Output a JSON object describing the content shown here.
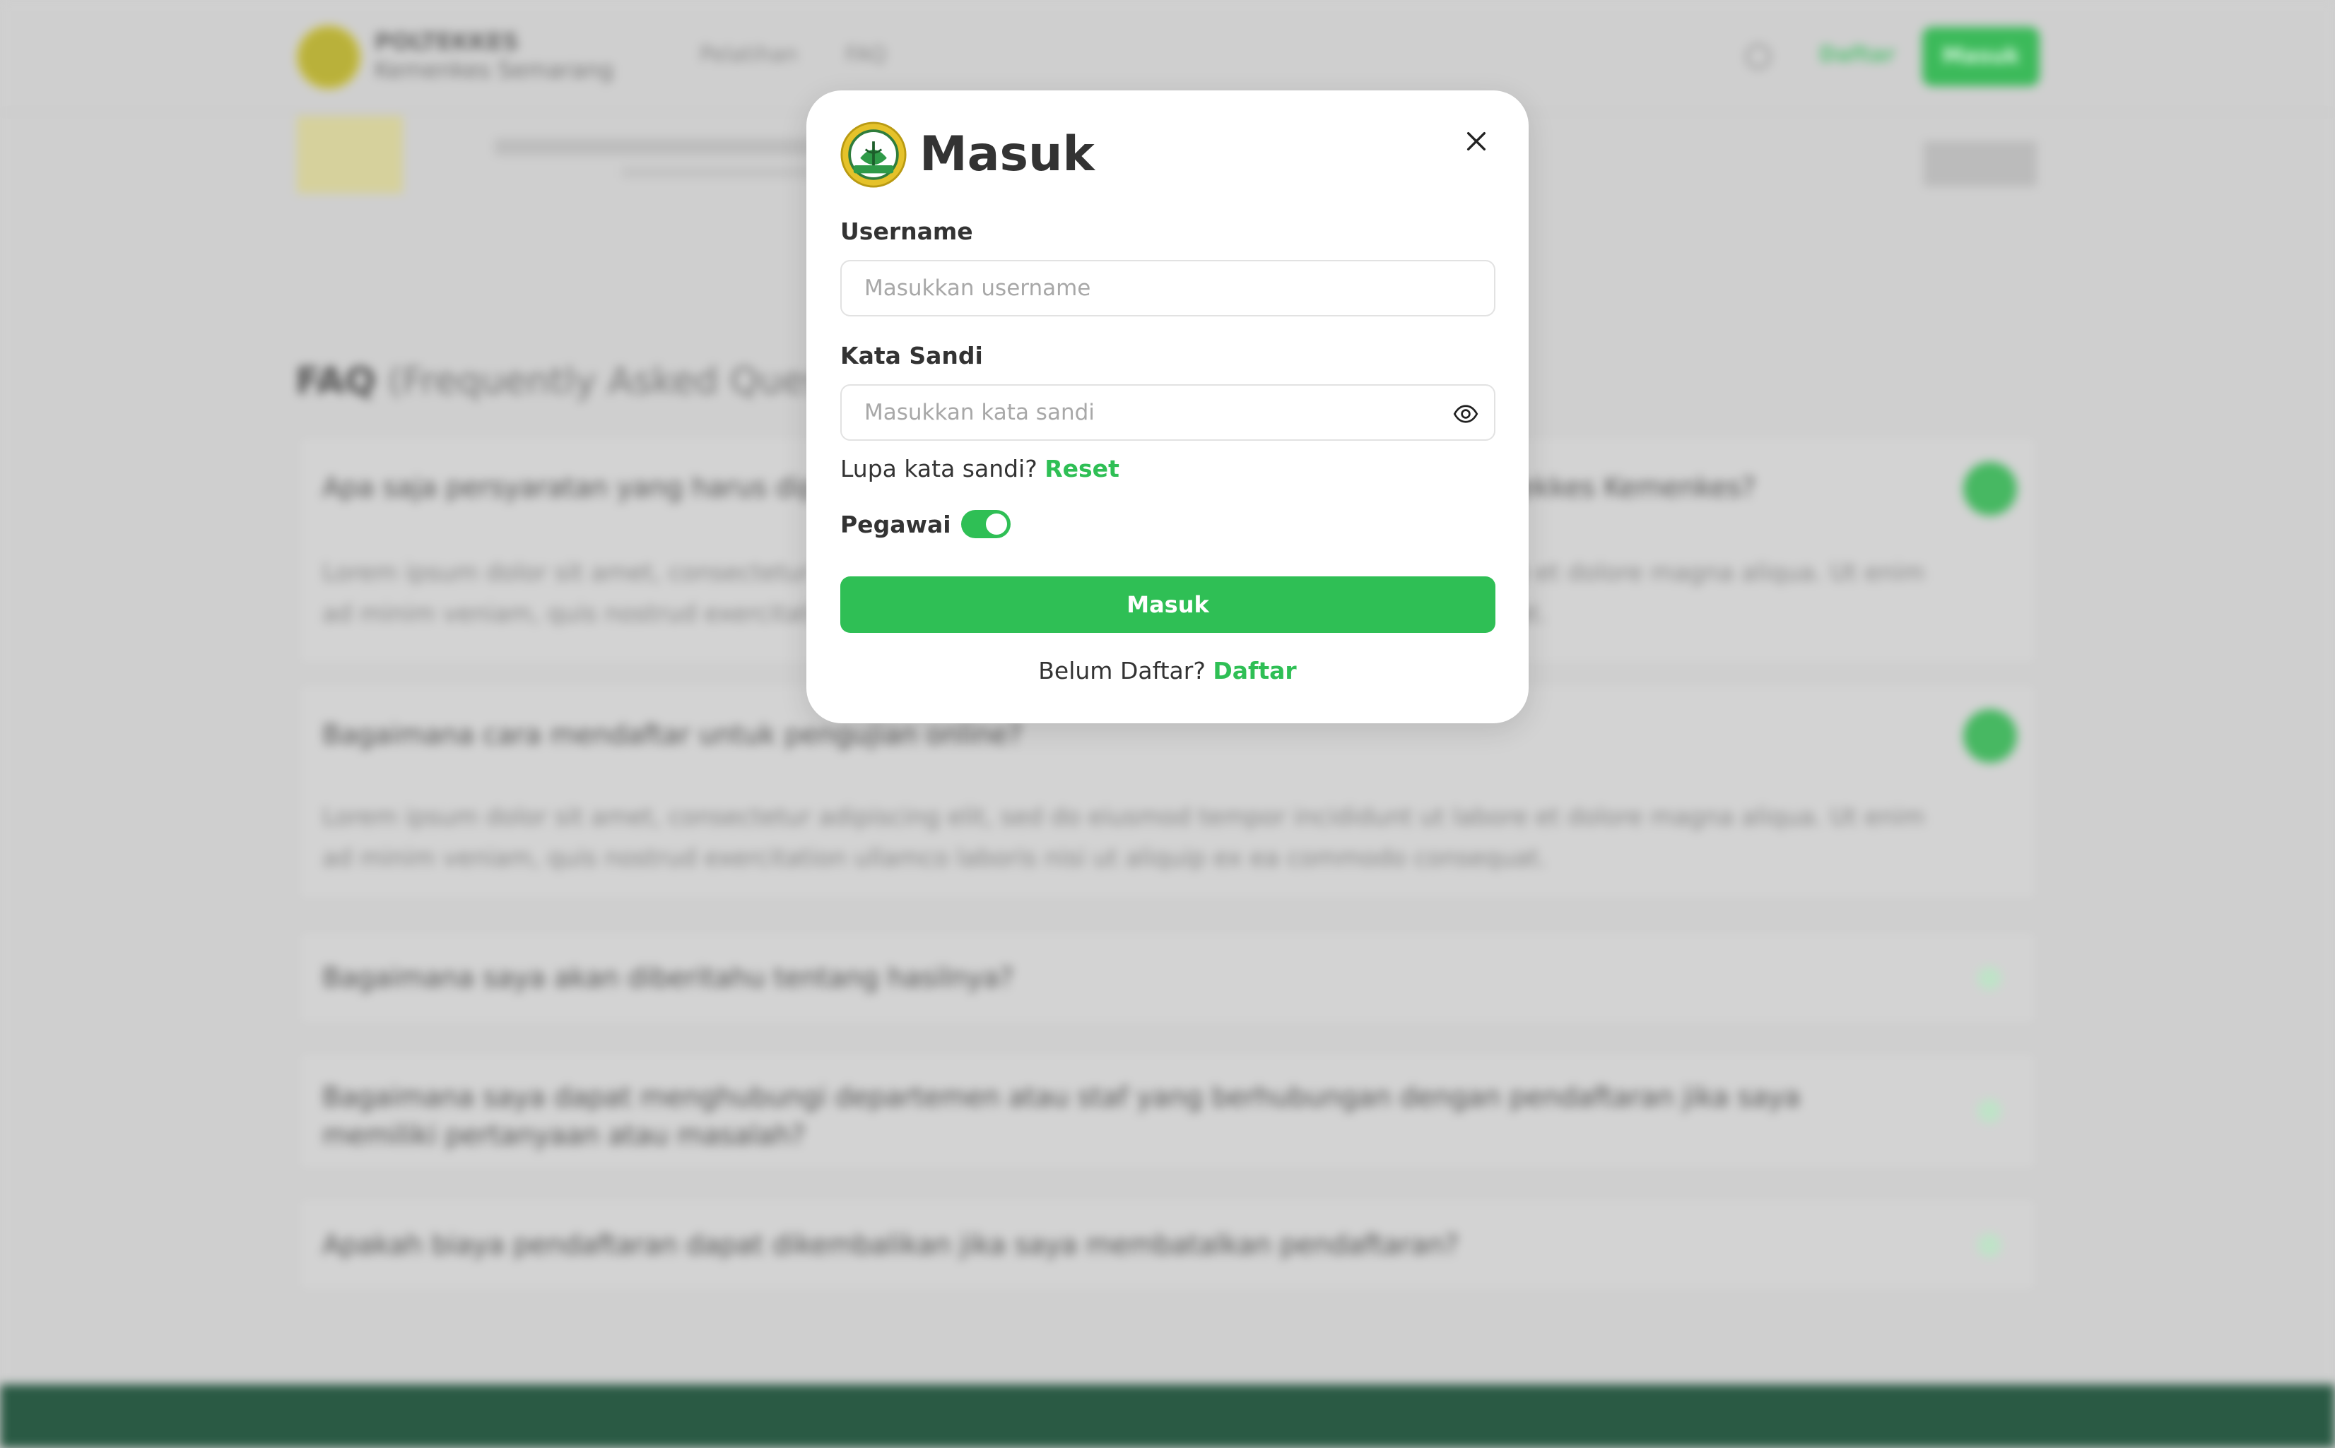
{
  "background": {
    "brand_line1": "POLTEKKES",
    "brand_line2": "Kemenkes Semarang",
    "nav": [
      "Pelatihan",
      "FAQ"
    ],
    "header_daftar": "Daftar",
    "header_masuk": "Masuk",
    "faq_title_bold": "FAQ",
    "faq_title_rest": " (Frequently Asked Questions)",
    "faq_items": [
      {
        "question": "Apa saja persyaratan yang harus dipenuhi untuk mengikuti pengujian kompetensi di Poltekkes Kemenkes?",
        "answer": "Lorem ipsum dolor sit amet, consectetur adipiscing elit, sed do eiusmod tempor incididunt ut labore et dolore magna aliqua. Ut enim ad minim veniam, quis nostrud exercitation ullamco laboris nisi ut aliquip ex ea commodo consequat."
      },
      {
        "question": "Bagaimana cara mendaftar untuk pengujian online?",
        "answer": "Lorem ipsum dolor sit amet, consectetur adipiscing elit, sed do eiusmod tempor incididunt ut labore et dolore magna aliqua. Ut enim ad minim veniam, quis nostrud exercitation ullamco laboris nisi ut aliquip ex ea commodo consequat."
      },
      {
        "question": "Bagaimana saya akan diberitahu tentang hasilnya?"
      },
      {
        "question": "Bagaimana saya dapat menghubungi departemen atau staf yang berhubungan dengan pendaftaran jika saya memiliki pertanyaan atau masalah?"
      },
      {
        "question": "Apakah biaya pendaftaran dapat dikembalikan jika saya membatalkan pendaftaran?"
      }
    ]
  },
  "modal": {
    "title": "Masuk",
    "username_label": "Username",
    "username_placeholder": "Masukkan username",
    "password_label": "Kata Sandi",
    "password_placeholder": "Masukkan kata sandi",
    "forgot_text": "Lupa kata sandi?",
    "reset_link": "Reset",
    "pegawai_label": "Pegawai",
    "pegawai_on": true,
    "submit_label": "Masuk",
    "signup_text": "Belum Daftar?",
    "signup_link": "Daftar"
  },
  "colors": {
    "accent": "#2fbf55",
    "footer": "#2a5a44",
    "logo_gold": "#e5c22a"
  },
  "icons": {
    "close": "close-icon",
    "password_toggle": "eye-icon",
    "logo": "poltekkes-logo"
  }
}
